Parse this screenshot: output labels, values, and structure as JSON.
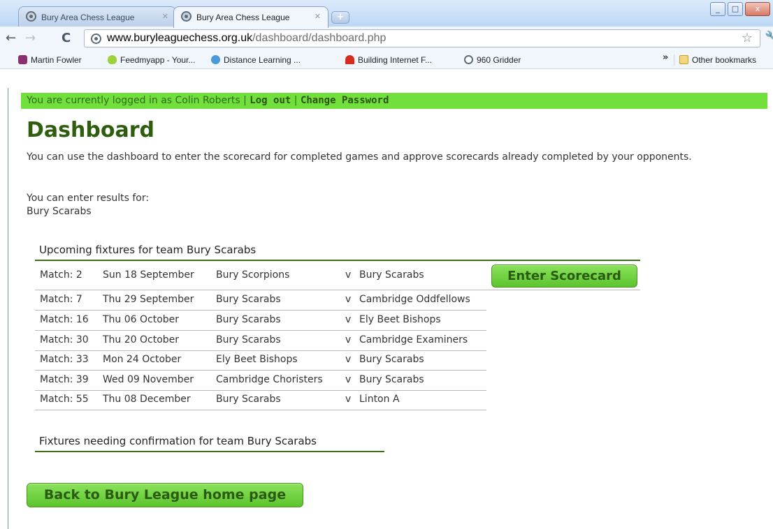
{
  "browser": {
    "tabs": [
      {
        "title": "Bury Area Chess League",
        "active": false
      },
      {
        "title": "Bury Area Chess League",
        "active": true
      }
    ],
    "address": {
      "host": "www.buryleaguechess.org.uk",
      "path": "/dashboard/dashboard.php"
    },
    "bookmarks": [
      {
        "label": "Martin Fowler",
        "icon": "martin-fowler-icon"
      },
      {
        "label": "Feedmyapp - Your...",
        "icon": "feedmyapp-icon"
      },
      {
        "label": "Distance Learning ...",
        "icon": "distance-learning-icon"
      },
      {
        "label": "Building Internet F...",
        "icon": "building-internet-icon"
      },
      {
        "label": "960 Gridder",
        "icon": "globe-icon"
      }
    ],
    "other_bookmarks": "Other bookmarks",
    "overflow_glyph": "»",
    "window_controls": {
      "minimize": "_",
      "maximize": "□",
      "close": "x"
    }
  },
  "login": {
    "prefix": "You are currently logged in as Colin Roberts",
    "sep": " | ",
    "logout": "Log out",
    "change_password": "Change Password"
  },
  "page": {
    "title": "Dashboard",
    "intro": "You can use the dashboard to enter the scorecard for completed games and approve scorecards already completed by your opponents.",
    "enter_results_label": "You can enter results for:",
    "team": "Bury Scarabs"
  },
  "upcoming": {
    "title": "Upcoming fixtures for team Bury Scarabs",
    "enter_button": "Enter Scorecard",
    "rows": [
      {
        "match": "Match: 2",
        "date": "Sun 18 September",
        "home": "Bury Scorpions",
        "v": "v",
        "away": "Bury Scarabs"
      },
      {
        "match": "Match: 7",
        "date": "Thu 29 September",
        "home": "Bury Scarabs",
        "v": "v",
        "away": "Cambridge Oddfellows"
      },
      {
        "match": "Match: 16",
        "date": "Thu 06 October",
        "home": "Bury Scarabs",
        "v": "v",
        "away": "Ely Beet Bishops"
      },
      {
        "match": "Match: 30",
        "date": "Thu 20 October",
        "home": "Bury Scarabs",
        "v": "v",
        "away": "Cambridge Examiners"
      },
      {
        "match": "Match: 33",
        "date": "Mon 24 October",
        "home": "Ely Beet Bishops",
        "v": "v",
        "away": "Bury Scarabs"
      },
      {
        "match": "Match: 39",
        "date": "Wed 09 November",
        "home": "Cambridge Choristers",
        "v": "v",
        "away": "Bury Scarabs"
      },
      {
        "match": "Match: 55",
        "date": "Thu 08 December",
        "home": "Bury Scarabs",
        "v": "v",
        "away": "Linton A"
      }
    ]
  },
  "confirmation": {
    "title": "Fixtures needing confirmation for team Bury Scarabs"
  },
  "back_button": "Back to Bury League home page",
  "colors": {
    "login_bar": "#72e03c",
    "title_green": "#2e5d0f",
    "button_green": "#5cc42d",
    "section_rule": "#3c6e1a"
  }
}
